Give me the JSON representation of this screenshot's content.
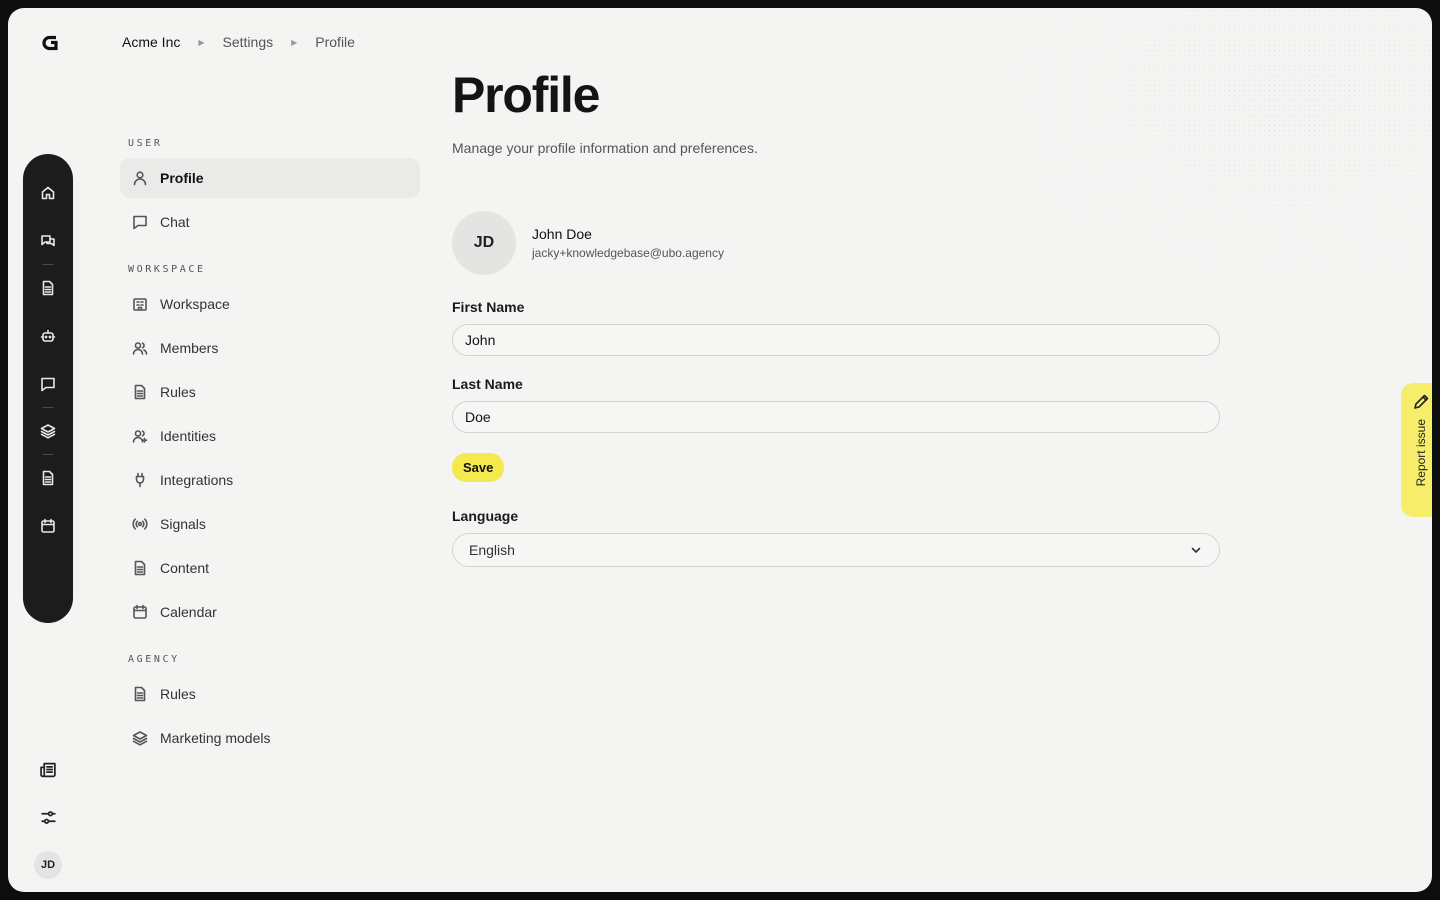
{
  "breadcrumb": {
    "org": "Acme Inc",
    "settings": "Settings",
    "current": "Profile"
  },
  "rail": {
    "icons": [
      "home-icon",
      "chats-icon",
      "document-icon",
      "robot-icon",
      "message-icon",
      "layers-icon",
      "document-icon",
      "calendar-icon"
    ]
  },
  "bottom": {
    "avatar_initials": "JD",
    "icons": [
      "newspaper-icon",
      "sliders-icon"
    ]
  },
  "nav": {
    "user_section": "User",
    "workspace_section": "Workspace",
    "agency_section": "Agency",
    "user_items": [
      {
        "label": "Profile",
        "icon": "user-icon"
      },
      {
        "label": "Chat",
        "icon": "chat-icon"
      }
    ],
    "workspace_items": [
      {
        "label": "Workspace",
        "icon": "building-icon"
      },
      {
        "label": "Members",
        "icon": "users-icon"
      },
      {
        "label": "Rules",
        "icon": "document-icon"
      },
      {
        "label": "Identities",
        "icon": "identities-icon"
      },
      {
        "label": "Integrations",
        "icon": "plug-icon"
      },
      {
        "label": "Signals",
        "icon": "signal-icon"
      },
      {
        "label": "Content",
        "icon": "document-icon"
      },
      {
        "label": "Calendar",
        "icon": "calendar-icon"
      }
    ],
    "agency_items": [
      {
        "label": "Rules",
        "icon": "document-icon"
      },
      {
        "label": "Marketing models",
        "icon": "layers-icon"
      }
    ]
  },
  "main": {
    "title": "Profile",
    "subtitle": "Manage your profile information and preferences.",
    "user": {
      "initials": "JD",
      "name": "John Doe",
      "email": "jacky+knowledgebase@ubo.agency"
    },
    "first_name": {
      "label": "First Name",
      "value": "John"
    },
    "last_name": {
      "label": "Last Name",
      "value": "Doe"
    },
    "save_label": "Save",
    "language": {
      "label": "Language",
      "value": "English"
    }
  },
  "report": {
    "label": "Report issue"
  },
  "colors": {
    "accent_yellow": "#f4ea4d",
    "rail_bg": "#1c1c1c",
    "page_bg": "#f4f4f3"
  }
}
